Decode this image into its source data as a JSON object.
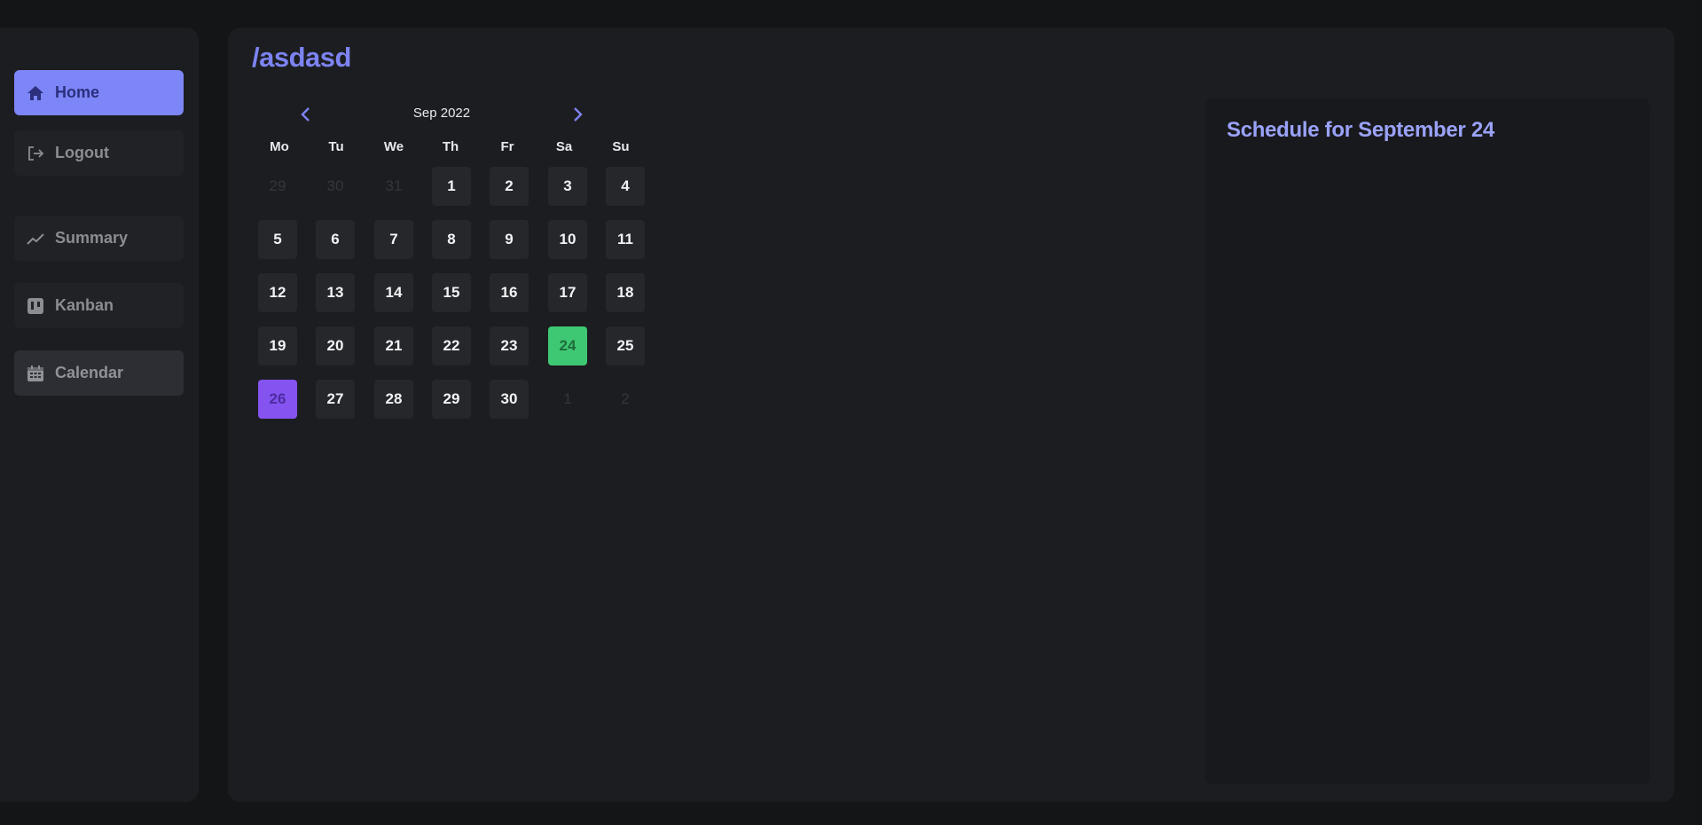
{
  "sidebar": {
    "items": [
      {
        "label": "Home",
        "icon": "home-icon"
      },
      {
        "label": "Logout",
        "icon": "logout-icon"
      },
      {
        "label": "Summary",
        "icon": "trend-line-icon"
      },
      {
        "label": "Kanban",
        "icon": "kanban-board-icon"
      },
      {
        "label": "Calendar",
        "icon": "calendar-icon"
      }
    ]
  },
  "main": {
    "title": "/asdasd"
  },
  "calendar": {
    "month_label": "Sep 2022",
    "weekdays": [
      "Mo",
      "Tu",
      "We",
      "Th",
      "Fr",
      "Sa",
      "Su"
    ],
    "weeks": [
      [
        "29",
        "30",
        "31",
        "1",
        "2",
        "3",
        "4"
      ],
      [
        "5",
        "6",
        "7",
        "8",
        "9",
        "10",
        "11"
      ],
      [
        "12",
        "13",
        "14",
        "15",
        "16",
        "17",
        "18"
      ],
      [
        "19",
        "20",
        "21",
        "22",
        "23",
        "24",
        "25"
      ],
      [
        "26",
        "27",
        "28",
        "29",
        "30",
        "1",
        "2"
      ]
    ],
    "selected_day": "24",
    "today": "26"
  },
  "schedule": {
    "title": "Schedule for September 24"
  },
  "colors": {
    "accent": "#7c84f2",
    "selected_day": "#3fc873",
    "today": "#8553f0",
    "background": "#141517",
    "panel": "#1c1d20"
  }
}
